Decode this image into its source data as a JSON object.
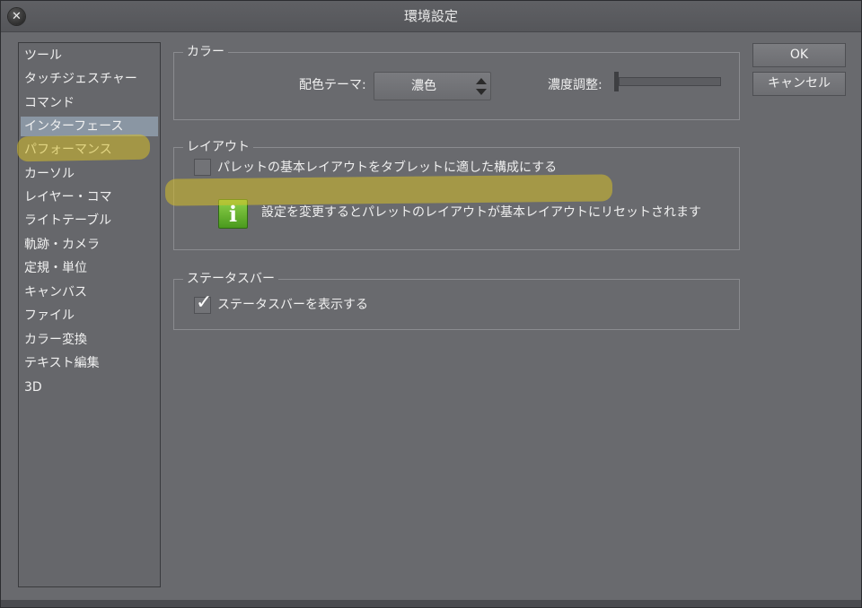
{
  "window": {
    "title": "環境設定"
  },
  "sidebar": {
    "items": [
      {
        "label": "ツール"
      },
      {
        "label": "タッチジェスチャー"
      },
      {
        "label": "コマンド"
      },
      {
        "label": "インターフェース",
        "selected": true
      },
      {
        "label": "パフォーマンス"
      },
      {
        "label": "カーソル"
      },
      {
        "label": "レイヤー・コマ"
      },
      {
        "label": "ライトテーブル"
      },
      {
        "label": "軌跡・カメラ"
      },
      {
        "label": "定規・単位"
      },
      {
        "label": "キャンバス"
      },
      {
        "label": "ファイル"
      },
      {
        "label": "カラー変換"
      },
      {
        "label": "テキスト編集"
      },
      {
        "label": "3D"
      }
    ]
  },
  "color_group": {
    "label": "カラー",
    "theme_label": "配色テーマ:",
    "theme_value": "濃色",
    "density_label": "濃度調整:",
    "density_value": 0
  },
  "layout_group": {
    "label": "レイアウト",
    "tablet_checkbox_label": "パレットの基本レイアウトをタブレットに適した構成にする",
    "tablet_checked": false,
    "info_text": "設定を変更するとパレットのレイアウトが基本レイアウトにリセットされます",
    "info_icon": "info-icon"
  },
  "statusbar_group": {
    "label": "ステータスバー",
    "show_checkbox_label": "ステータスバーを表示する",
    "show_checked": true
  },
  "buttons": {
    "ok": "OK",
    "cancel": "キャンセル"
  },
  "colors": {
    "selected_bg": "#8a96a3",
    "highlight": "#d6be28",
    "info_green": "#6bb534"
  }
}
